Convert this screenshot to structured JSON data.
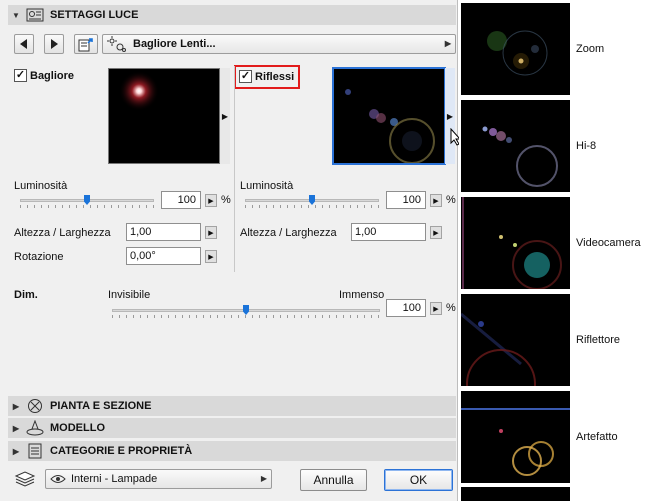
{
  "header": {
    "title": "SETTAGGI LUCE"
  },
  "nav": {
    "preset_label": "Bagliore Lenti..."
  },
  "glow": {
    "checkbox_label": "Bagliore",
    "checked": true,
    "brightness_label": "Luminosità",
    "brightness_value": "100",
    "brightness_level": 0.5,
    "unit": "%",
    "ratio_label": "Altezza / Larghezza",
    "ratio_value": "1,00",
    "rotation_label": "Rotazione",
    "rotation_value": "0,00°"
  },
  "reflections": {
    "checkbox_label": "Riflessi",
    "checked": true,
    "brightness_label": "Luminosità",
    "brightness_value": "100",
    "brightness_level": 0.5,
    "unit": "%",
    "ratio_label": "Altezza / Larghezza",
    "ratio_value": "1,00"
  },
  "size": {
    "label": "Dim.",
    "min_label": "Invisibile",
    "max_label": "Immenso",
    "value": "100",
    "level": 0.5,
    "unit": "%"
  },
  "sections": [
    {
      "label": "PIANTA E SEZIONE",
      "icon": "floor-plan-icon"
    },
    {
      "label": "MODELLO",
      "icon": "model-icon"
    },
    {
      "label": "CATEGORIE E PROPRIETÀ",
      "icon": "categories-icon"
    }
  ],
  "footer": {
    "layer_value": "Interni - Lampade",
    "cancel_label": "Annulla",
    "ok_label": "OK"
  },
  "presets": [
    {
      "name": "Zoom"
    },
    {
      "name": "Hi-8"
    },
    {
      "name": "Videocamera"
    },
    {
      "name": "Riflettore"
    },
    {
      "name": "Artefatto"
    }
  ],
  "colors": {
    "highlight": "#e21b1b",
    "slider_thumb": "#1a73d9",
    "selection": "#2b72d6"
  }
}
